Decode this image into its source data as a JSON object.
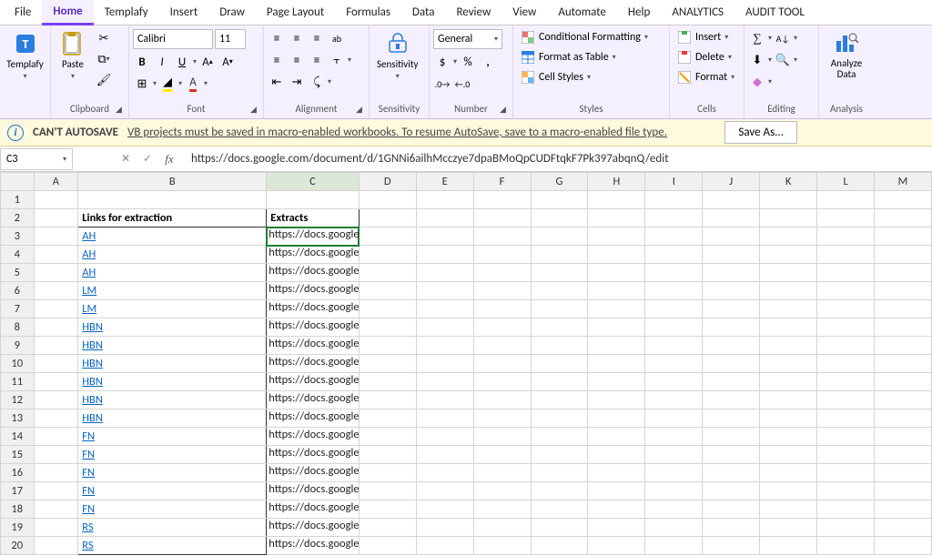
{
  "tabs": [
    "File",
    "Home",
    "Templafy",
    "Insert",
    "Draw",
    "Page Layout",
    "Formulas",
    "Data",
    "Review",
    "View",
    "Automate",
    "Help",
    "ANALYTICS",
    "AUDIT TOOL"
  ],
  "activeTab": "Home",
  "ribbon": {
    "templafy": "Templafy",
    "clipboard": {
      "paste": "Paste",
      "label": "Clipboard"
    },
    "font": {
      "name": "Calibri",
      "size": "11",
      "label": "Font"
    },
    "alignment": {
      "label": "Alignment",
      "wrap": "ab"
    },
    "sensitivity": {
      "btn": "Sensitivity",
      "label": "Sensitivity"
    },
    "number": {
      "format": "General",
      "label": "Number"
    },
    "styles": {
      "cond": "Conditional Formatting",
      "table": "Format as Table",
      "cell": "Cell Styles",
      "label": "Styles"
    },
    "cells": {
      "insert": "Insert",
      "delete": "Delete",
      "format": "Format",
      "label": "Cells"
    },
    "editing": {
      "label": "Editing"
    },
    "analysis": {
      "btn": "Analyze Data",
      "label": "Analysis"
    }
  },
  "autosave": {
    "title": "CAN'T AUTOSAVE",
    "msg": "VB projects must be saved in macro-enabled workbooks. To resume AutoSave, save to a macro-enabled file type.",
    "saveas": "Save As..."
  },
  "nameBox": "C3",
  "formula": "https://docs.google.com/document/d/1GNNi6ailhMcczye7dpaBMoQpCUDFtqkF7Pk397abqnQ/edit",
  "columns": [
    "A",
    "B",
    "C",
    "D",
    "E",
    "F",
    "G",
    "H",
    "I",
    "J",
    "K",
    "L",
    "M"
  ],
  "headers": {
    "b2": "Links for extraction",
    "c2": "Extracts"
  },
  "url": "https://docs.google.com/document/d/1GNNi6ailhMcczye7dpaBMoQpCUDFtqkF7Pk397abqnQ/edit",
  "rows": [
    {
      "n": 3,
      "b": "AH"
    },
    {
      "n": 4,
      "b": "AH"
    },
    {
      "n": 5,
      "b": "AH"
    },
    {
      "n": 6,
      "b": "LM"
    },
    {
      "n": 7,
      "b": "LM"
    },
    {
      "n": 8,
      "b": "HBN"
    },
    {
      "n": 9,
      "b": "HBN"
    },
    {
      "n": 10,
      "b": "HBN"
    },
    {
      "n": 11,
      "b": "HBN"
    },
    {
      "n": 12,
      "b": "HBN"
    },
    {
      "n": 13,
      "b": "HBN"
    },
    {
      "n": 14,
      "b": "FN"
    },
    {
      "n": 15,
      "b": "FN"
    },
    {
      "n": 16,
      "b": "FN"
    },
    {
      "n": 17,
      "b": "FN"
    },
    {
      "n": 18,
      "b": "FN"
    },
    {
      "n": 19,
      "b": "RS"
    },
    {
      "n": 20,
      "b": "RS"
    }
  ]
}
